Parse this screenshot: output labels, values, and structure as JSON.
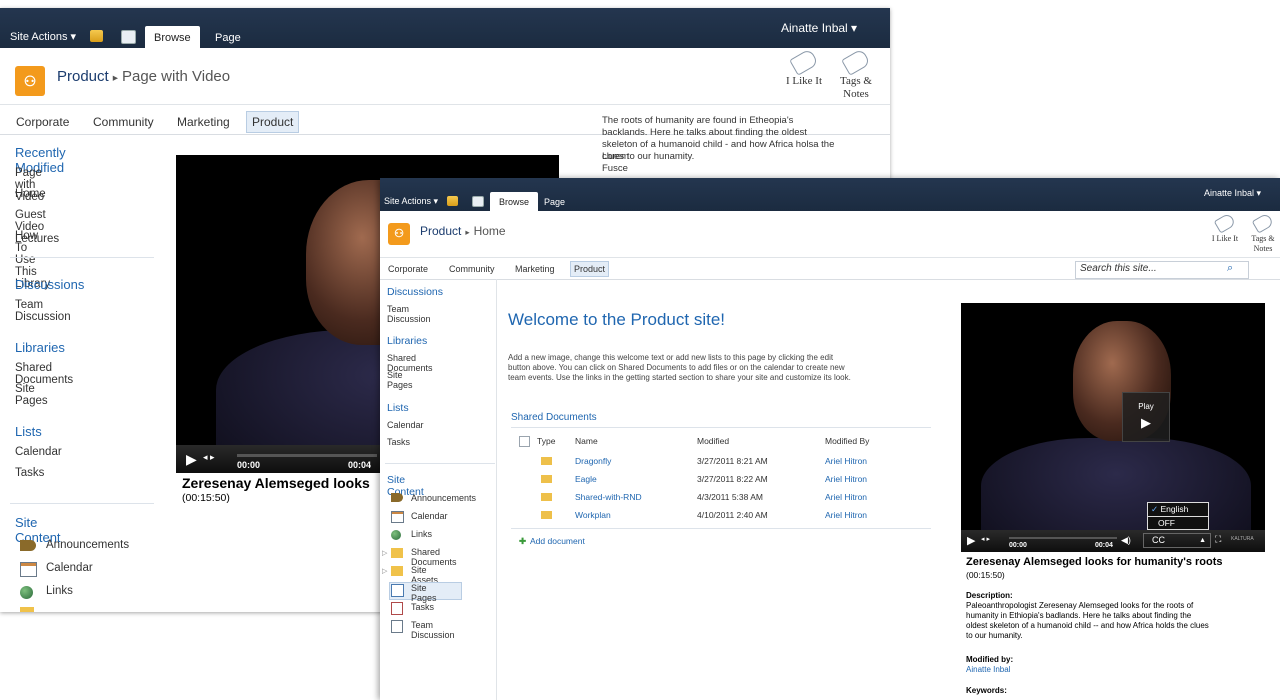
{
  "win1": {
    "ribbon": {
      "site_actions": "Site Actions ▾",
      "tab_browse": "Browse",
      "tab_page": "Page",
      "user": "Ainatte Inbal ▾"
    },
    "breadcrumb": {
      "site": "Product",
      "page": "Page with Video"
    },
    "social": {
      "like": "I Like It",
      "tags": "Tags &",
      "notes": "Notes"
    },
    "topnav": [
      "Corporate",
      "Community",
      "Marketing",
      "Product"
    ],
    "quicklaunch": {
      "recent_h": "Recently Modified",
      "recent": [
        "Page with Video",
        "Home",
        "Guest Video Lectures",
        "How To Use This Library"
      ],
      "discussions_h": "Discussions",
      "discussions": [
        "Team Discussion"
      ],
      "libraries_h": "Libraries",
      "libraries": [
        "Shared Documents",
        "Site Pages"
      ],
      "lists_h": "Lists",
      "lists": [
        "Calendar",
        "Tasks"
      ],
      "sitecontent_h": "Site Content",
      "sitecontent": [
        "Announcements",
        "Calendar",
        "Links"
      ]
    },
    "video": {
      "time_start": "00:00",
      "time_end": "00:04",
      "title": "Zeresenay Alemseged looks",
      "duration": "(00:15:50)"
    }
  },
  "tooltip": {
    "lines": [
      "The roots of humanity are found in Etheopia's",
      "backlands. Here he talks about finding the oldest",
      "skeleton of a humanoid child - and how Africa holsa the",
      "clues to our hunamity."
    ],
    "extra1": "Lorem",
    "extra2": "Fusce"
  },
  "win2": {
    "ribbon": {
      "site_actions": "Site Actions ▾",
      "tab_browse": "Browse",
      "tab_page": "Page",
      "user": "Ainatte Inbal ▾"
    },
    "breadcrumb": {
      "site": "Product",
      "page": "Home"
    },
    "social": {
      "like": "I Like It",
      "tags": "Tags &",
      "notes": "Notes"
    },
    "topnav": [
      "Corporate",
      "Community",
      "Marketing",
      "Product"
    ],
    "search_placeholder": "Search this site...",
    "quicklaunch": {
      "discussions_h": "Discussions",
      "discussions": [
        "Team Discussion"
      ],
      "libraries_h": "Libraries",
      "libraries": [
        "Shared Documents",
        "Site Pages"
      ],
      "lists_h": "Lists",
      "lists": [
        "Calendar",
        "Tasks"
      ],
      "sitecontent_h": "Site Content",
      "sitecontent": [
        "Announcements",
        "Calendar",
        "Links",
        "Shared Documents",
        "Site Assets",
        "Site Pages",
        "Tasks",
        "Team Discussion"
      ]
    },
    "welcome": "Welcome to the Product site!",
    "intro": [
      "Add a new image, change this welcome text or add new lists to this page by clicking the edit",
      "button above. You can click on Shared Documents to add files or on the calendar to create new",
      "team events. Use the links in the getting started section to share your site and customize its look."
    ],
    "docs": {
      "title": "Shared Documents",
      "headers": [
        "Type",
        "Name",
        "Modified",
        "Modified By"
      ],
      "rows": [
        {
          "name": "Dragonfly",
          "modified": "3/27/2011 8:21 AM",
          "by": "Ariel Hitron"
        },
        {
          "name": "Eagle",
          "modified": "3/27/2011 8:22 AM",
          "by": "Ariel Hitron"
        },
        {
          "name": "Shared-with-RND",
          "modified": "4/3/2011 5:38 AM",
          "by": "Ariel Hitron"
        },
        {
          "name": "Workplan",
          "modified": "4/10/2011 2:40 AM",
          "by": "Ariel Hitron"
        }
      ],
      "add": "Add document"
    },
    "video": {
      "play": "Play",
      "cc_english": "English",
      "cc_off": "OFF",
      "cc": "CC",
      "time_start": "00:00",
      "time_end": "00:04",
      "brand": "KALTURA",
      "title": "Zeresenay Alemseged looks for humanity's roots",
      "duration": "(00:15:50)",
      "desc_h": "Description:",
      "desc": [
        "Paleoanthropologist Zeresenay Alemseged looks for the roots of",
        "humanity in Ethiopia's badlands. Here he talks about finding the",
        "oldest skeleton of a humanoid child -- and how Africa holds the clues",
        "to our humanity."
      ],
      "modby_h": "Modified by:",
      "modby": "Ainatte Inbal",
      "keywords_h": "Keywords:"
    }
  },
  "colors": {
    "ribbon": "#1f3049",
    "link": "#1f66b0",
    "accent": "#f39a1c"
  }
}
